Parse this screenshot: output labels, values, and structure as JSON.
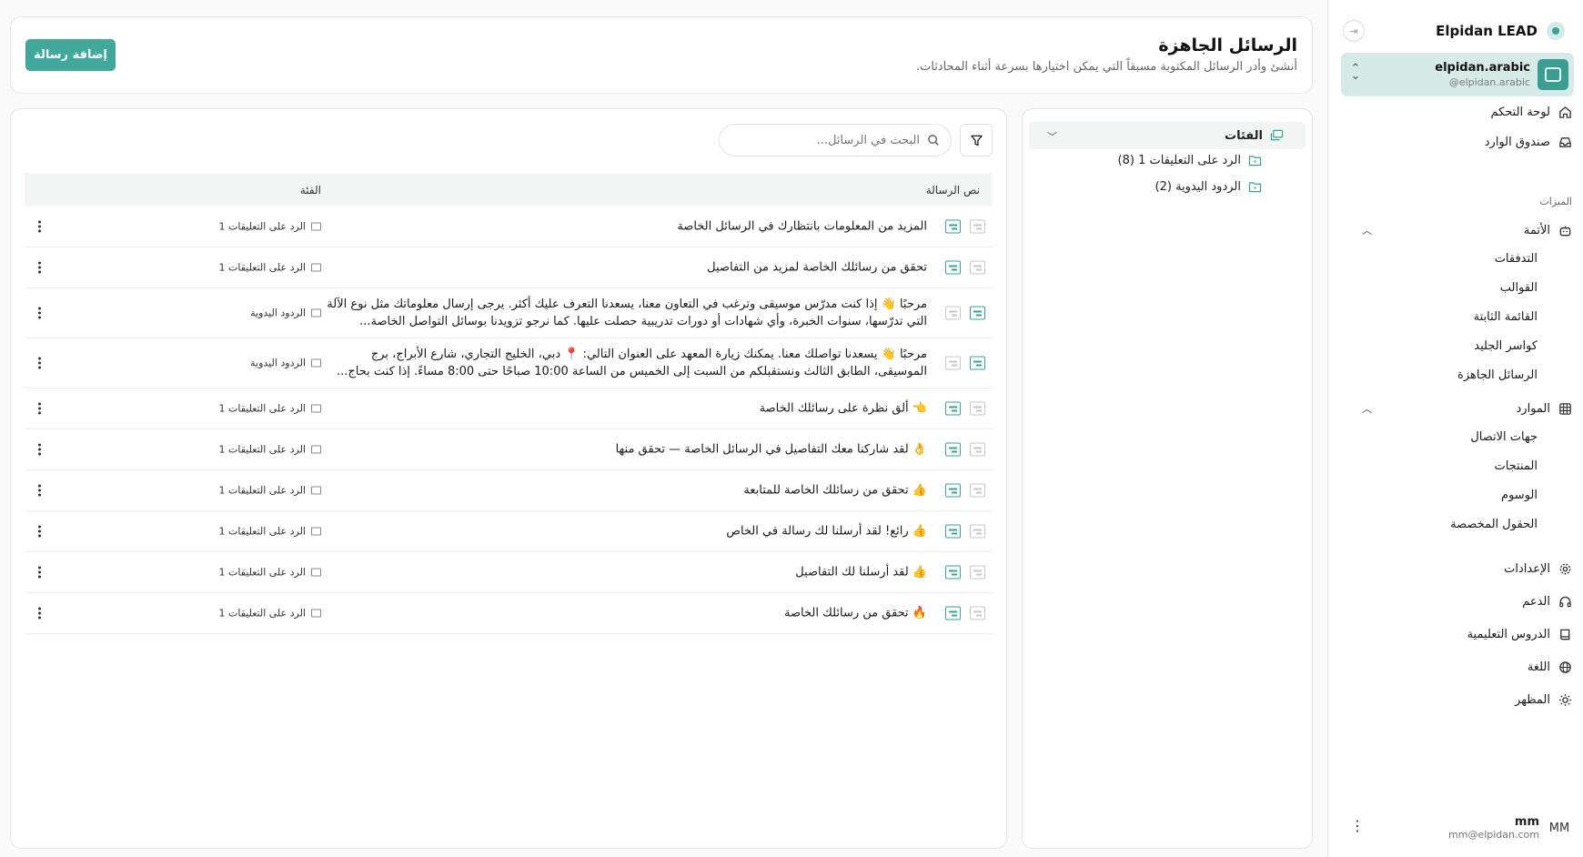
{
  "app": {
    "brand": "Elpidan LEAD"
  },
  "account": {
    "name": "elpidan.arabic",
    "handle": "@elpidan.arabic"
  },
  "nav": {
    "dashboard": "لوحة التحكم",
    "inbox": "صندوق الوارد",
    "features_label": "الميزات",
    "automation": "الأتمة",
    "automation_items": [
      "التدفقات",
      "القوالب",
      "القائمة الثابتة",
      "كواسر الجليد",
      "الرسائل الجاهزة"
    ],
    "resources": "الموارد",
    "resources_items": [
      "جهات الاتصال",
      "المنتجات",
      "الوسوم",
      "الحقول المخصصة"
    ],
    "settings": "الإعدادات",
    "support": "الدعم",
    "tutorials": "الدروس التعليمية",
    "language": "اللغة",
    "appearance": "المظهر"
  },
  "user": {
    "initials": "MM",
    "name": "mm",
    "email": "mm@elpidan.com"
  },
  "header": {
    "title": "الرسائل الجاهزة",
    "subtitle": "أنشئ وأدر الرسائل المكتوبة مسبقاً التي يمكن اختيارها بسرعة أثناء المحادثات.",
    "add_button": "إضافة رسالة"
  },
  "categories": {
    "title": "الفئات",
    "items": [
      "الرد على التعليقات 1 (8)",
      "الردود اليدوية (2)"
    ]
  },
  "search": {
    "placeholder": "البحث في الرسائل..."
  },
  "table": {
    "col_text": "نص الرسالة",
    "col_category": "الفئة",
    "rows": [
      {
        "text": "المزيد من المعلومات بانتظارك في الرسائل الخاصة",
        "category": "الرد على التعليقات 1",
        "kind": "comment"
      },
      {
        "text": "تحقق من رسائلك الخاصة لمزيد من التفاصيل",
        "category": "الرد على التعليقات 1",
        "kind": "comment"
      },
      {
        "text": "مرحبًا 👋 إذا كنت مدرّس موسيقى وترغب في التعاون معنا، يسعدنا التعرف عليك أكثر. يرجى إرسال معلوماتك مثل نوع الآلة التي تدرّسها، سنوات الخبرة، وأي شهادات أو دورات تدريبية حصلت عليها. كما نرجو تزويدنا بوسائل التواصل الخاصة...",
        "category": "الردود اليدوية",
        "kind": "manual"
      },
      {
        "text": "مرحبًا 👋 يسعدنا تواصلك معنا. يمكنك زيارة المعهد على العنوان التالي: 📍 دبي، الخليج التجاري، شارع الأبراج، برج الموسيقى، الطابق الثالث ونستقبلكم من السبت إلى الخميس من الساعة 10:00 صباحًا حتى 8:00 مساءً. إذا كنت بحاج...",
        "category": "الردود اليدوية",
        "kind": "manual"
      },
      {
        "text": "👈 ألق نظرة على رسائلك الخاصة",
        "category": "الرد على التعليقات 1",
        "kind": "comment"
      },
      {
        "text": "👌 لقد شاركنا معك التفاصيل في الرسائل الخاصة — تحقق منها",
        "category": "الرد على التعليقات 1",
        "kind": "comment"
      },
      {
        "text": "👍 تحقق من رسائلك الخاصة للمتابعة",
        "category": "الرد على التعليقات 1",
        "kind": "comment"
      },
      {
        "text": "👍 رائع! لقد أرسلنا لك رسالة في الخاص",
        "category": "الرد على التعليقات 1",
        "kind": "comment"
      },
      {
        "text": "👍 لقد أرسلنا لك التفاصيل",
        "category": "الرد على التعليقات 1",
        "kind": "comment"
      },
      {
        "text": "🔥 تحقق من رسائلك الخاصة",
        "category": "الرد على التعليقات 1",
        "kind": "comment"
      }
    ]
  },
  "colors": {
    "accent": "#42a89b",
    "account_bg": "#d6ebe8"
  }
}
